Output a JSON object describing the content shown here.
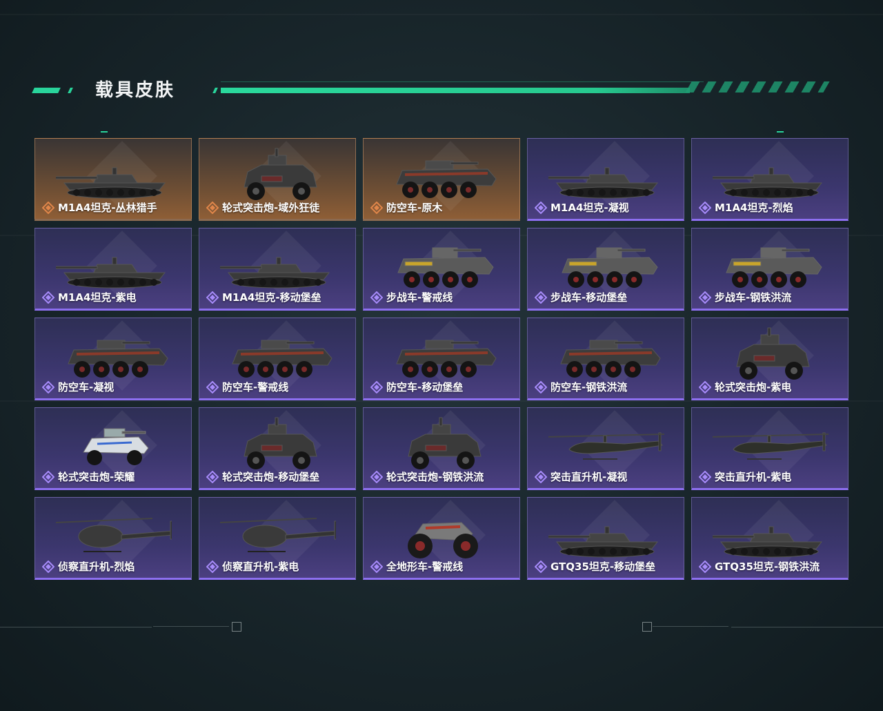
{
  "title": "载具皮肤",
  "colors": {
    "accent": "#29d49b",
    "purple": "#8d6ff0",
    "orange": "#d67a3a"
  },
  "skins": [
    {
      "name": "M1A4坦克-丛林猎手",
      "rarity": "orange",
      "vehicle": "tank"
    },
    {
      "name": "轮式突击炮-域外狂徒",
      "rarity": "orange",
      "vehicle": "assault"
    },
    {
      "name": "防空车-原木",
      "rarity": "orange",
      "vehicle": "apc"
    },
    {
      "name": "M1A4坦克-凝视",
      "rarity": "purple",
      "vehicle": "tank"
    },
    {
      "name": "M1A4坦克-烈焰",
      "rarity": "purple",
      "vehicle": "tank"
    },
    {
      "name": "M1A4坦克-紫电",
      "rarity": "purple",
      "vehicle": "tank"
    },
    {
      "name": "M1A4坦克-移动堡垒",
      "rarity": "purple",
      "vehicle": "tank"
    },
    {
      "name": "步战车-警戒线",
      "rarity": "purple",
      "vehicle": "ifv"
    },
    {
      "name": "步战车-移动堡垒",
      "rarity": "purple",
      "vehicle": "ifv"
    },
    {
      "name": "步战车-钢铁洪流",
      "rarity": "purple",
      "vehicle": "ifv"
    },
    {
      "name": "防空车-凝视",
      "rarity": "purple",
      "vehicle": "apc"
    },
    {
      "name": "防空车-警戒线",
      "rarity": "purple",
      "vehicle": "apc"
    },
    {
      "name": "防空车-移动堡垒",
      "rarity": "purple",
      "vehicle": "apc"
    },
    {
      "name": "防空车-钢铁洪流",
      "rarity": "purple",
      "vehicle": "apc"
    },
    {
      "name": "轮式突击炮-紫电",
      "rarity": "purple",
      "vehicle": "assault"
    },
    {
      "name": "轮式突击炮-荣耀",
      "rarity": "purple",
      "vehicle": "buggy"
    },
    {
      "name": "轮式突击炮-移动堡垒",
      "rarity": "purple",
      "vehicle": "assault"
    },
    {
      "name": "轮式突击炮-钢铁洪流",
      "rarity": "purple",
      "vehicle": "assault"
    },
    {
      "name": "突击直升机-凝视",
      "rarity": "purple",
      "vehicle": "attack-heli"
    },
    {
      "name": "突击直升机-紫电",
      "rarity": "purple",
      "vehicle": "attack-heli"
    },
    {
      "name": "侦察直升机-烈焰",
      "rarity": "purple",
      "vehicle": "scout-heli"
    },
    {
      "name": "侦察直升机-紫电",
      "rarity": "purple",
      "vehicle": "scout-heli"
    },
    {
      "name": "全地形车-警戒线",
      "rarity": "purple",
      "vehicle": "atv"
    },
    {
      "name": "GTQ35坦克-移动堡垒",
      "rarity": "purple",
      "vehicle": "tank"
    },
    {
      "name": "GTQ35坦克-钢铁洪流",
      "rarity": "purple",
      "vehicle": "tank"
    }
  ]
}
